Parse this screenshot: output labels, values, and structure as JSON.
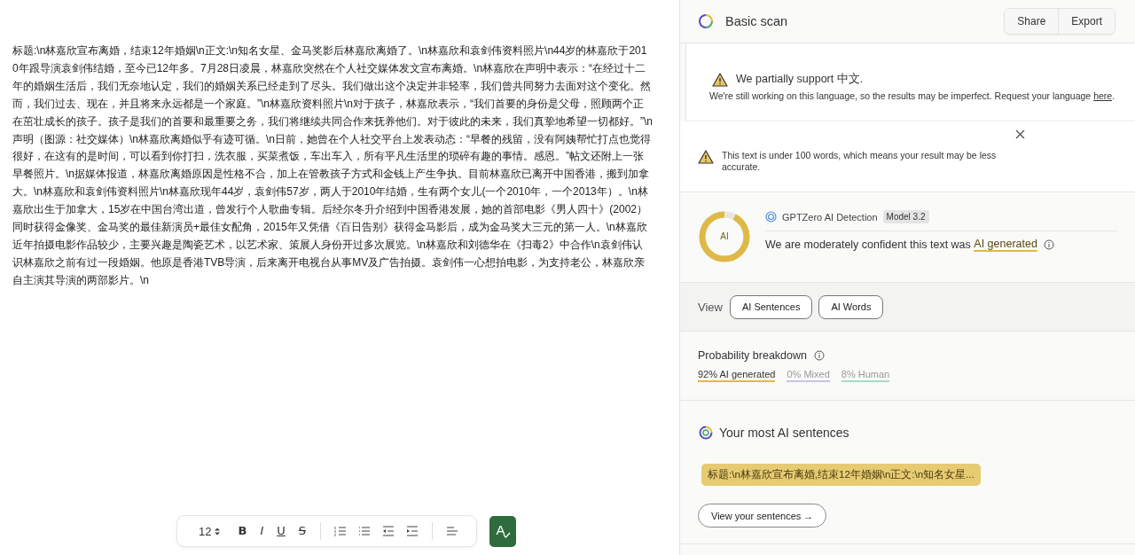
{
  "document": {
    "text": "标题:\\n林嘉欣宣布离婚，结束12年婚姻\\n正文:\\n知名女星、金马奖影后林嘉欣离婚了。\\n林嘉欣和袁剑伟资料照片\\n44岁的林嘉欣于2010年跟导演袁剑伟结婚，至今已12年多。7月28日凌晨，林嘉欣突然在个人社交媒体发文宣布离婚。\\n林嘉欣在声明中表示：“在经过十二年的婚姻生活后，我们无奈地认定，我们的婚姻关系已经走到了尽头。我们做出这个决定并非轻率，我们曾共同努力去面对这个变化。然而，我们过去、现在，并且将来永远都是一个家庭。”\\n林嘉欣资料照片\\n对于孩子，林嘉欣表示，“我们首要的身份是父母，照顾两个正在茁壮成长的孩子。孩子是我们的首要和最重要之务，我们将继续共同合作来抚养他们。对于彼此的未来，我们真挚地希望一切都好。”\\n声明（图源：社交媒体）\\n林嘉欣离婚似乎有迹可循。\\n日前，她曾在个人社交平台上发表动态：“早餐的残留，没有阿姨帮忙打点也觉得很好，在这有的是时间，可以看到你打扫，洗衣服，买菜煮饭，车出车入，所有平凡生活里的琐碎有趣的事情。感恩。”帖文还附上一张早餐照片。\\n据媒体报道，林嘉欣离婚原因是性格不合，加上在管教孩子方式和金钱上产生争执。目前林嘉欣已离开中国香港，搬到加拿大。\\n林嘉欣和袁剑伟资料照片\\n林嘉欣现年44岁，袁剑伟57岁，两人于2010年结婚，生有两个女儿(一个2010年，一个2013年）。\\n林嘉欣出生于加拿大，15岁在中国台湾出道，曾发行个人歌曲专辑。后经尔冬升介绍到中国香港发展，她的首部电影《男人四十》(2002）同时获得金像奖、金马奖的最佳新演员+最佳女配角，2015年又凭借《百日告别》获得金马影后，成为金马奖大三元的第一人。\\n林嘉欣近年拍摄电影作品较少，主要兴趣是陶瓷艺术，以艺术家、策展人身份开过多次展览。\\n林嘉欣和刘德华在《扫毒2》中合作\\n袁剑伟认识林嘉欣之前有过一段婚姻。他原是香港TVB导演，后来离开电视台从事MV及广告拍摄。袁剑伟一心想拍电影，为支持老公，林嘉欣亲自主演其导演的两部影片。\\n"
  },
  "toolbar": {
    "font_size": "12",
    "format_letters": [
      "B",
      "I",
      "U",
      "S"
    ],
    "check_button": {
      "label": "A"
    }
  },
  "panel": {
    "title": "Basic scan",
    "buttons": [
      "Share",
      "Export"
    ],
    "language_notice": {
      "title": "We partially support 中文.",
      "body": "We're still working on this language, so the results may be imperfect. Request your language ",
      "link": "here",
      "end": "."
    },
    "length_notice": {
      "text": "This text is under 100 words, which means your result may be less accurate."
    },
    "result": {
      "level": 0.92,
      "ring_label": "AI",
      "detector": "GPTZero AI Detection",
      "model": "Model 3.2",
      "verdict": "We are moderately confident this text was ",
      "verdict_highlight": "AI generated"
    },
    "view": {
      "label": "View",
      "buttons": [
        "AI Sentences",
        "AI Words"
      ]
    },
    "breakdown": {
      "title": "Probability breakdown",
      "items": [
        {
          "text": "92% AI generated",
          "color": "#e1ba48",
          "selected": true
        },
        {
          "text": "0% Mixed",
          "color": "#c9c3e8",
          "selected": false
        },
        {
          "text": "8% Human",
          "color": "#a8d9c6",
          "selected": false
        }
      ]
    },
    "most_ai": {
      "title": "Your most AI sentences",
      "sentences": [
        "标题:\\n林嘉欣宣布离婚,结束12年婚姻\\n正文:\\n知名女星..."
      ],
      "button": "View your sentences →"
    }
  }
}
